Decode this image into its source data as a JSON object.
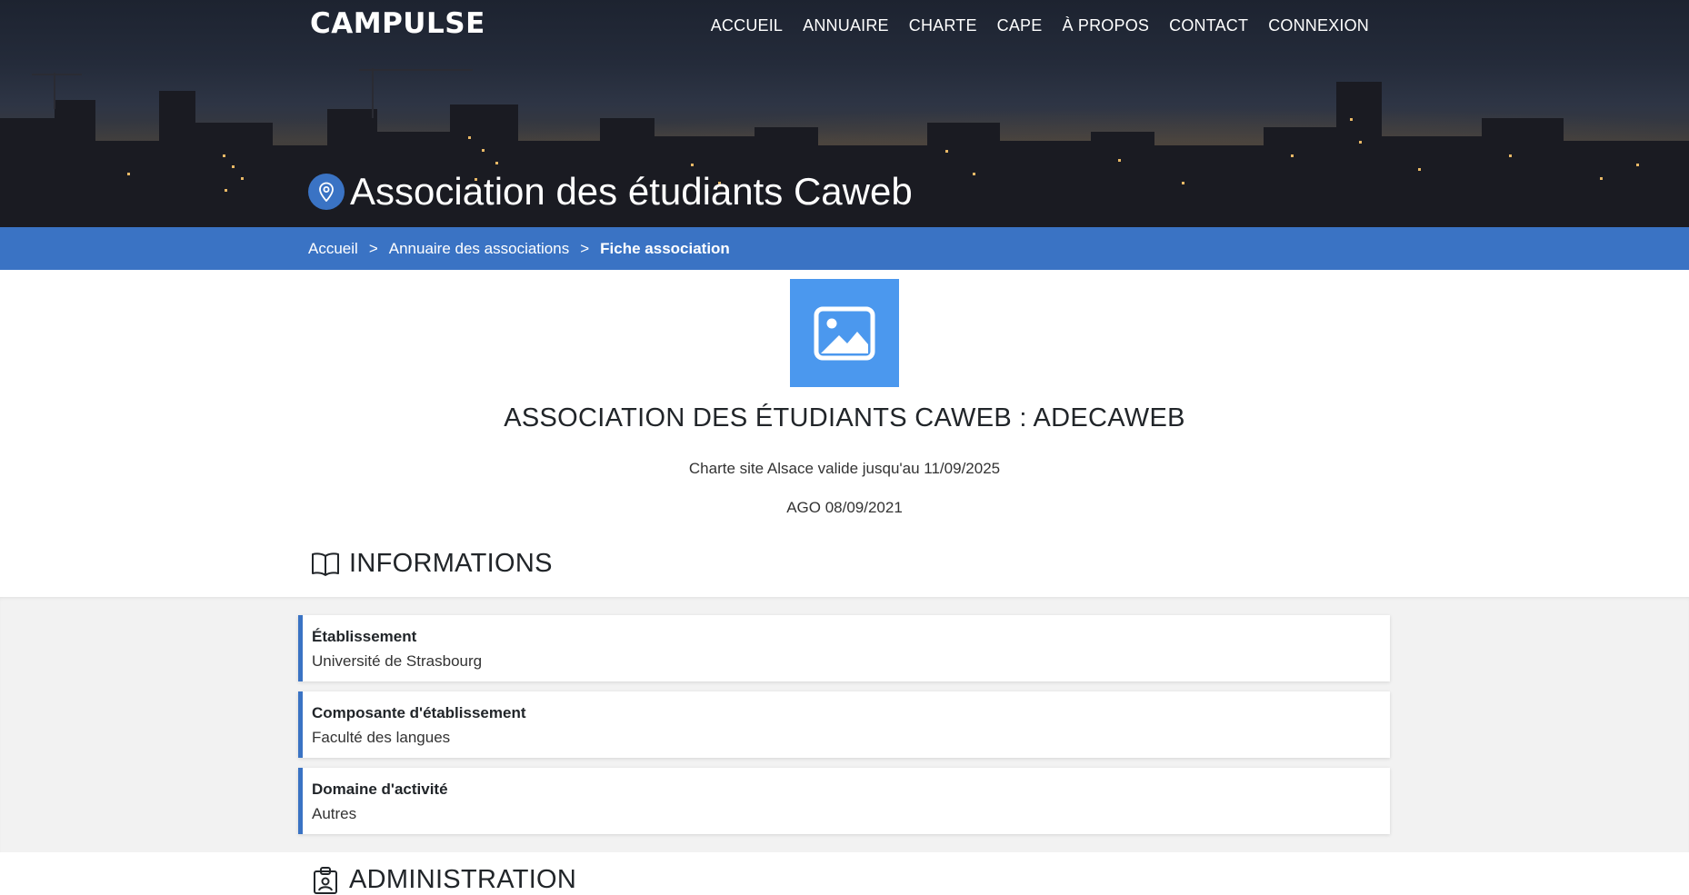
{
  "brand": {
    "name": "CAMPULSE"
  },
  "nav": {
    "items": [
      {
        "label": "ACCUEIL"
      },
      {
        "label": "ANNUAIRE"
      },
      {
        "label": "CHARTE"
      },
      {
        "label": "CAPE"
      },
      {
        "label": "À PROPOS"
      },
      {
        "label": "CONTACT"
      },
      {
        "label": "CONNEXION"
      }
    ]
  },
  "page": {
    "title": "Association des étudiants Caweb",
    "title_icon": "map-pin-icon"
  },
  "breadcrumb": {
    "items": [
      {
        "label": "Accueil"
      },
      {
        "label": "Annuaire des associations"
      },
      {
        "label": "Fiche association"
      }
    ],
    "separator": ">"
  },
  "association": {
    "image_icon": "image-placeholder-icon",
    "name": "ASSOCIATION DES ÉTUDIANTS CAWEB : ADECAWEB",
    "charte": "Charte site Alsace valide jusqu'au 11/09/2025",
    "ago": "AGO 08/09/2021"
  },
  "informations": {
    "title": "INFORMATIONS",
    "icon": "book-icon",
    "cards": [
      {
        "label": "Établissement",
        "value": "Université de Strasbourg"
      },
      {
        "label": "Composante d'établissement",
        "value": "Faculté des langues"
      },
      {
        "label": "Domaine d'activité",
        "value": "Autres"
      }
    ]
  },
  "administration": {
    "title": "ADMINISTRATION",
    "icon": "clipboard-user-icon"
  },
  "colors": {
    "primary_blue": "#3a73c4",
    "image_blue": "#4b98ee",
    "band_grey": "#f2f2f2"
  }
}
